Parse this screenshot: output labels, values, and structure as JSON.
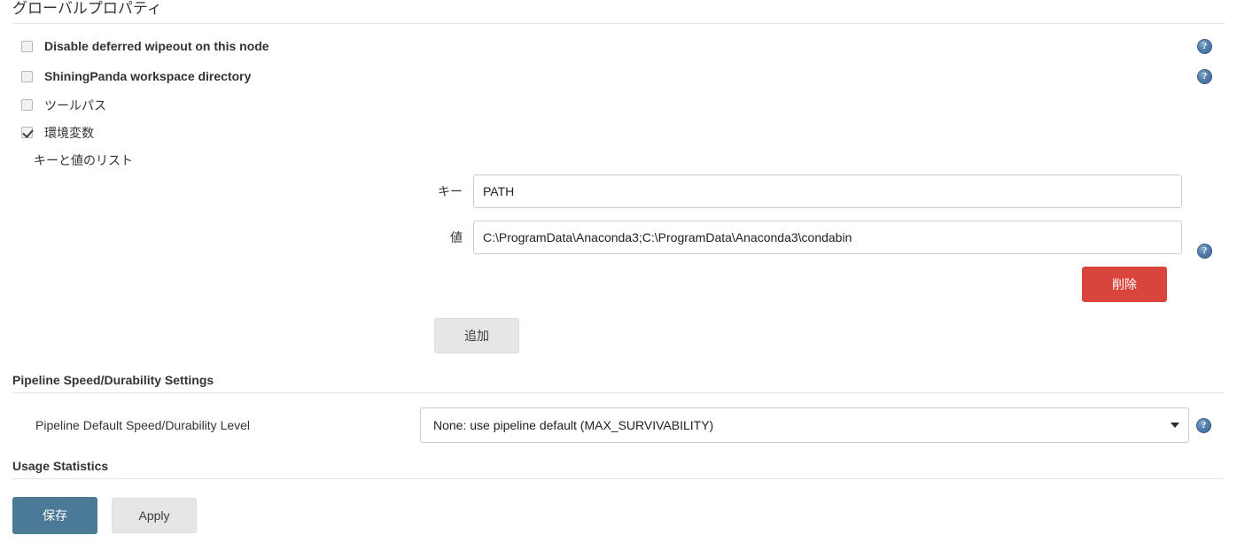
{
  "header": {
    "title": "グローバルプロパティ"
  },
  "options": [
    {
      "label": "Disable deferred wipeout on this node",
      "checked": false,
      "style": "en",
      "help": true
    },
    {
      "label": "ShiningPanda workspace directory",
      "checked": false,
      "style": "en",
      "help": true
    },
    {
      "label": "ツールパス",
      "checked": false,
      "style": "jp",
      "help": false
    },
    {
      "label": "環境変数",
      "checked": true,
      "style": "jp",
      "help": false
    }
  ],
  "env_vars": {
    "list_label": "キーと値のリスト",
    "key_label": "キー",
    "key_value": "PATH",
    "value_label": "値",
    "value_value": "C:\\ProgramData\\Anaconda3;C:\\ProgramData\\Anaconda3\\condabin",
    "delete_label": "削除",
    "add_label": "追加"
  },
  "pipeline": {
    "section_title": "Pipeline Speed/Durability Settings",
    "field_label": "Pipeline Default Speed/Durability Level",
    "selected_option": "None: use pipeline default (MAX_SURVIVABILITY)"
  },
  "usage": {
    "section_title": "Usage Statistics"
  },
  "footer": {
    "save_label": "保存",
    "apply_label": "Apply"
  },
  "icons": {
    "help": "?"
  },
  "colors": {
    "danger": "#d9453d",
    "primary": "#4b7a96",
    "secondary": "#e6e6e6",
    "help_blue": "#3b6390"
  }
}
